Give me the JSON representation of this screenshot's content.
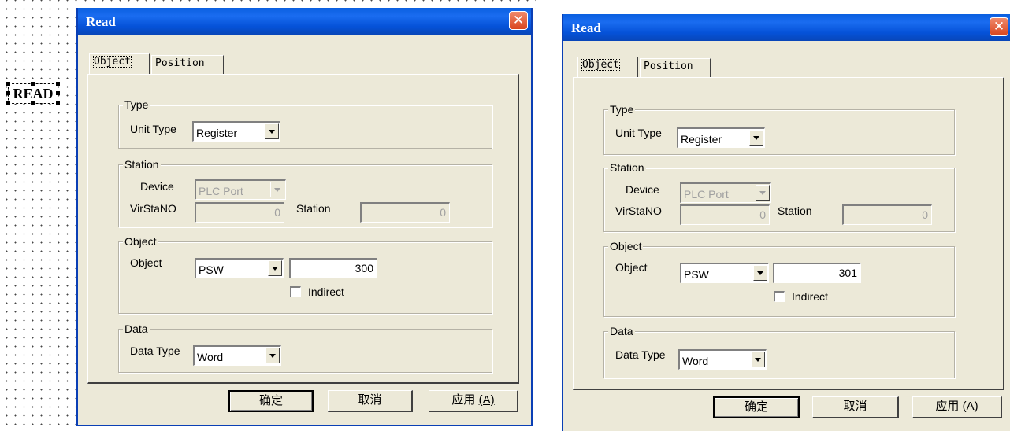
{
  "canvas": {
    "widget_label": "READ"
  },
  "dialogs": [
    {
      "title": "Read",
      "close_glyph": "✕",
      "tabs": [
        "Object",
        "Position"
      ],
      "type": {
        "legend": "Type",
        "unit_type_label": "Unit Type",
        "unit_type_value": "Register"
      },
      "station": {
        "legend": "Station",
        "device_label": "Device",
        "device_value": "PLC Port",
        "virstano_label": "VirStaNO",
        "virstano_value": "0",
        "station_label": "Station",
        "station_value": "0"
      },
      "object": {
        "legend": "Object",
        "object_label": "Object",
        "object_type": "PSW",
        "object_address": "300",
        "indirect_label": "Indirect"
      },
      "data": {
        "legend": "Data",
        "data_type_label": "Data Type",
        "data_type_value": "Word"
      },
      "buttons": {
        "ok": "确定",
        "cancel": "取消",
        "apply": "应用",
        "apply_key": "(A)"
      }
    },
    {
      "title": "Read",
      "close_glyph": "✕",
      "tabs": [
        "Object",
        "Position"
      ],
      "type": {
        "legend": "Type",
        "unit_type_label": "Unit Type",
        "unit_type_value": "Register"
      },
      "station": {
        "legend": "Station",
        "device_label": "Device",
        "device_value": "PLC Port",
        "virstano_label": "VirStaNO",
        "virstano_value": "0",
        "station_label": "Station",
        "station_value": "0"
      },
      "object": {
        "legend": "Object",
        "object_label": "Object",
        "object_type": "PSW",
        "object_address": "301",
        "indirect_label": "Indirect"
      },
      "data": {
        "legend": "Data",
        "data_type_label": "Data Type",
        "data_type_value": "Word"
      },
      "buttons": {
        "ok": "确定",
        "cancel": "取消",
        "apply": "应用",
        "apply_key": "(A)"
      }
    }
  ]
}
